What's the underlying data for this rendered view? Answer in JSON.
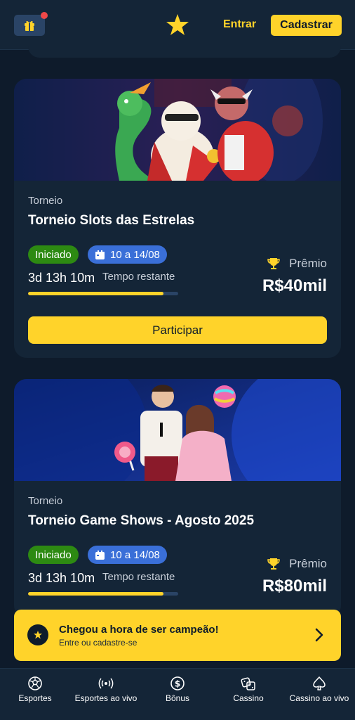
{
  "header": {
    "login_label": "Entrar",
    "signup_label": "Cadastrar"
  },
  "tournaments": [
    {
      "type": "Torneio",
      "title": "Torneio Slots das Estrelas",
      "status": "Iniciado",
      "dates": "10 a 14/08",
      "time_left": "3d 13h 10m",
      "time_label": "Tempo restante",
      "progress": 0.9,
      "prize_label": "Prêmio",
      "prize_value": "R$40mil",
      "join_label": "Participar"
    },
    {
      "type": "Torneio",
      "title": "Torneio Game Shows - Agosto 2025",
      "status": "Iniciado",
      "dates": "10 a 14/08",
      "time_left": "3d 13h 10m",
      "time_label": "Tempo restante",
      "progress": 0.9,
      "prize_label": "Prêmio",
      "prize_value": "R$80mil"
    }
  ],
  "cta": {
    "title": "Chegou a hora de ser campeão!",
    "subtitle": "Entre ou cadastre-se"
  },
  "bottom_nav": [
    {
      "label": "Esportes",
      "icon": "soccer-ball-icon"
    },
    {
      "label": "Esportes ao vivo",
      "icon": "broadcast-icon"
    },
    {
      "label": "Bônus",
      "icon": "dollar-coin-icon"
    },
    {
      "label": "Cassino",
      "icon": "dice-icon"
    },
    {
      "label": "Cassino ao vivo",
      "icon": "spade-icon"
    }
  ],
  "colors": {
    "background": "#0e1b2b",
    "card": "#142537",
    "accent": "#ffd32a",
    "status_green": "#2d8a12",
    "date_blue": "#3a6fd8"
  }
}
